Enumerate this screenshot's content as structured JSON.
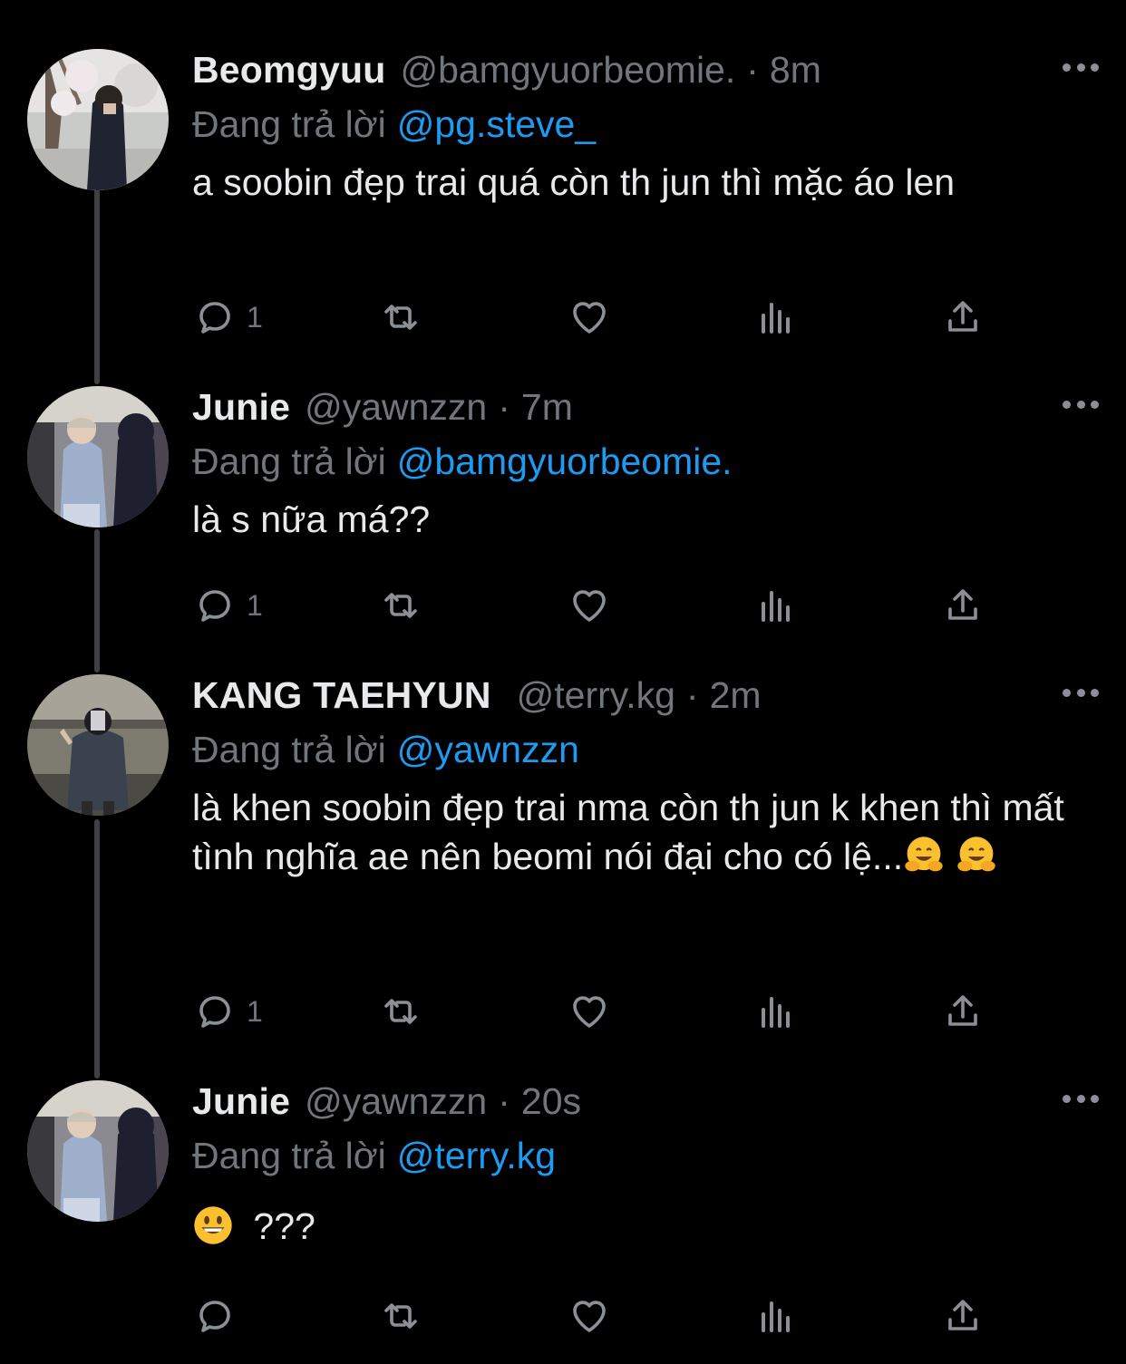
{
  "tweets": [
    {
      "name": "Beomgyuu",
      "handle": "@bamgyuorbeomie.",
      "separator": "·",
      "time": "8m",
      "reply_prefix": "Đang trả lời",
      "reply_to": "@pg.steve_",
      "text": "a soobin đẹp trai quá còn th jun thì mặc áo len",
      "reply_count": "1"
    },
    {
      "name": "Junie",
      "handle": "@yawnzzn",
      "separator": "·",
      "time": "7m",
      "reply_prefix": "Đang trả lời",
      "reply_to": "@bamgyuorbeomie.",
      "text": "là s nữa má??",
      "reply_count": "1"
    },
    {
      "name": "KANG TAEHYUN",
      "handle": "@terry.kg",
      "separator": "·",
      "time": "2m",
      "reply_prefix": "Đang trả lời",
      "reply_to": "@yawnzzn",
      "text": "là khen soobin đẹp trai nma còn th jun k khen thì mất tình nghĩa ae nên beomi nói đại cho có lệ...",
      "emoji": [
        "hugging-face",
        "hugging-face"
      ],
      "reply_count": "1"
    },
    {
      "name": "Junie",
      "handle": "@yawnzzn",
      "separator": "·",
      "time": "20s",
      "reply_prefix": "Đang trả lời",
      "reply_to": "@terry.kg",
      "text": "???",
      "emoji_before": "smiling-face",
      "reply_count": ""
    }
  ],
  "icons": {
    "reply": "reply-icon",
    "retweet": "retweet-icon",
    "like": "heart-icon",
    "views": "views-icon",
    "share": "share-icon",
    "more": "more-icon"
  },
  "colors": {
    "background": "#000000",
    "text": "#e7e9ea",
    "secondary": "#71767b",
    "mention": "#1d9bf0",
    "thread_line": "#3e4144"
  }
}
